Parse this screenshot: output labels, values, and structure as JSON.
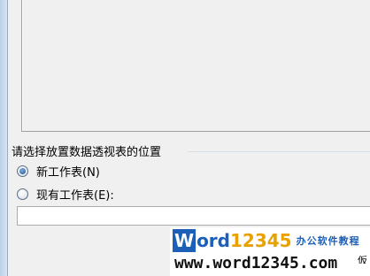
{
  "placement_group": {
    "title": "请选择放置数据透视表的位置",
    "new_worksheet_label": "新工作表(N)",
    "existing_worksheet_label": "现有工作表(E):",
    "selected": "new_worksheet",
    "location_value": ""
  },
  "watermark": {
    "brand_w": "W",
    "brand_ord": "ord",
    "brand_num": "12345",
    "brand_sub": "办公软件教程",
    "url": "www.word12345.com"
  },
  "corner_button_label": "仮"
}
